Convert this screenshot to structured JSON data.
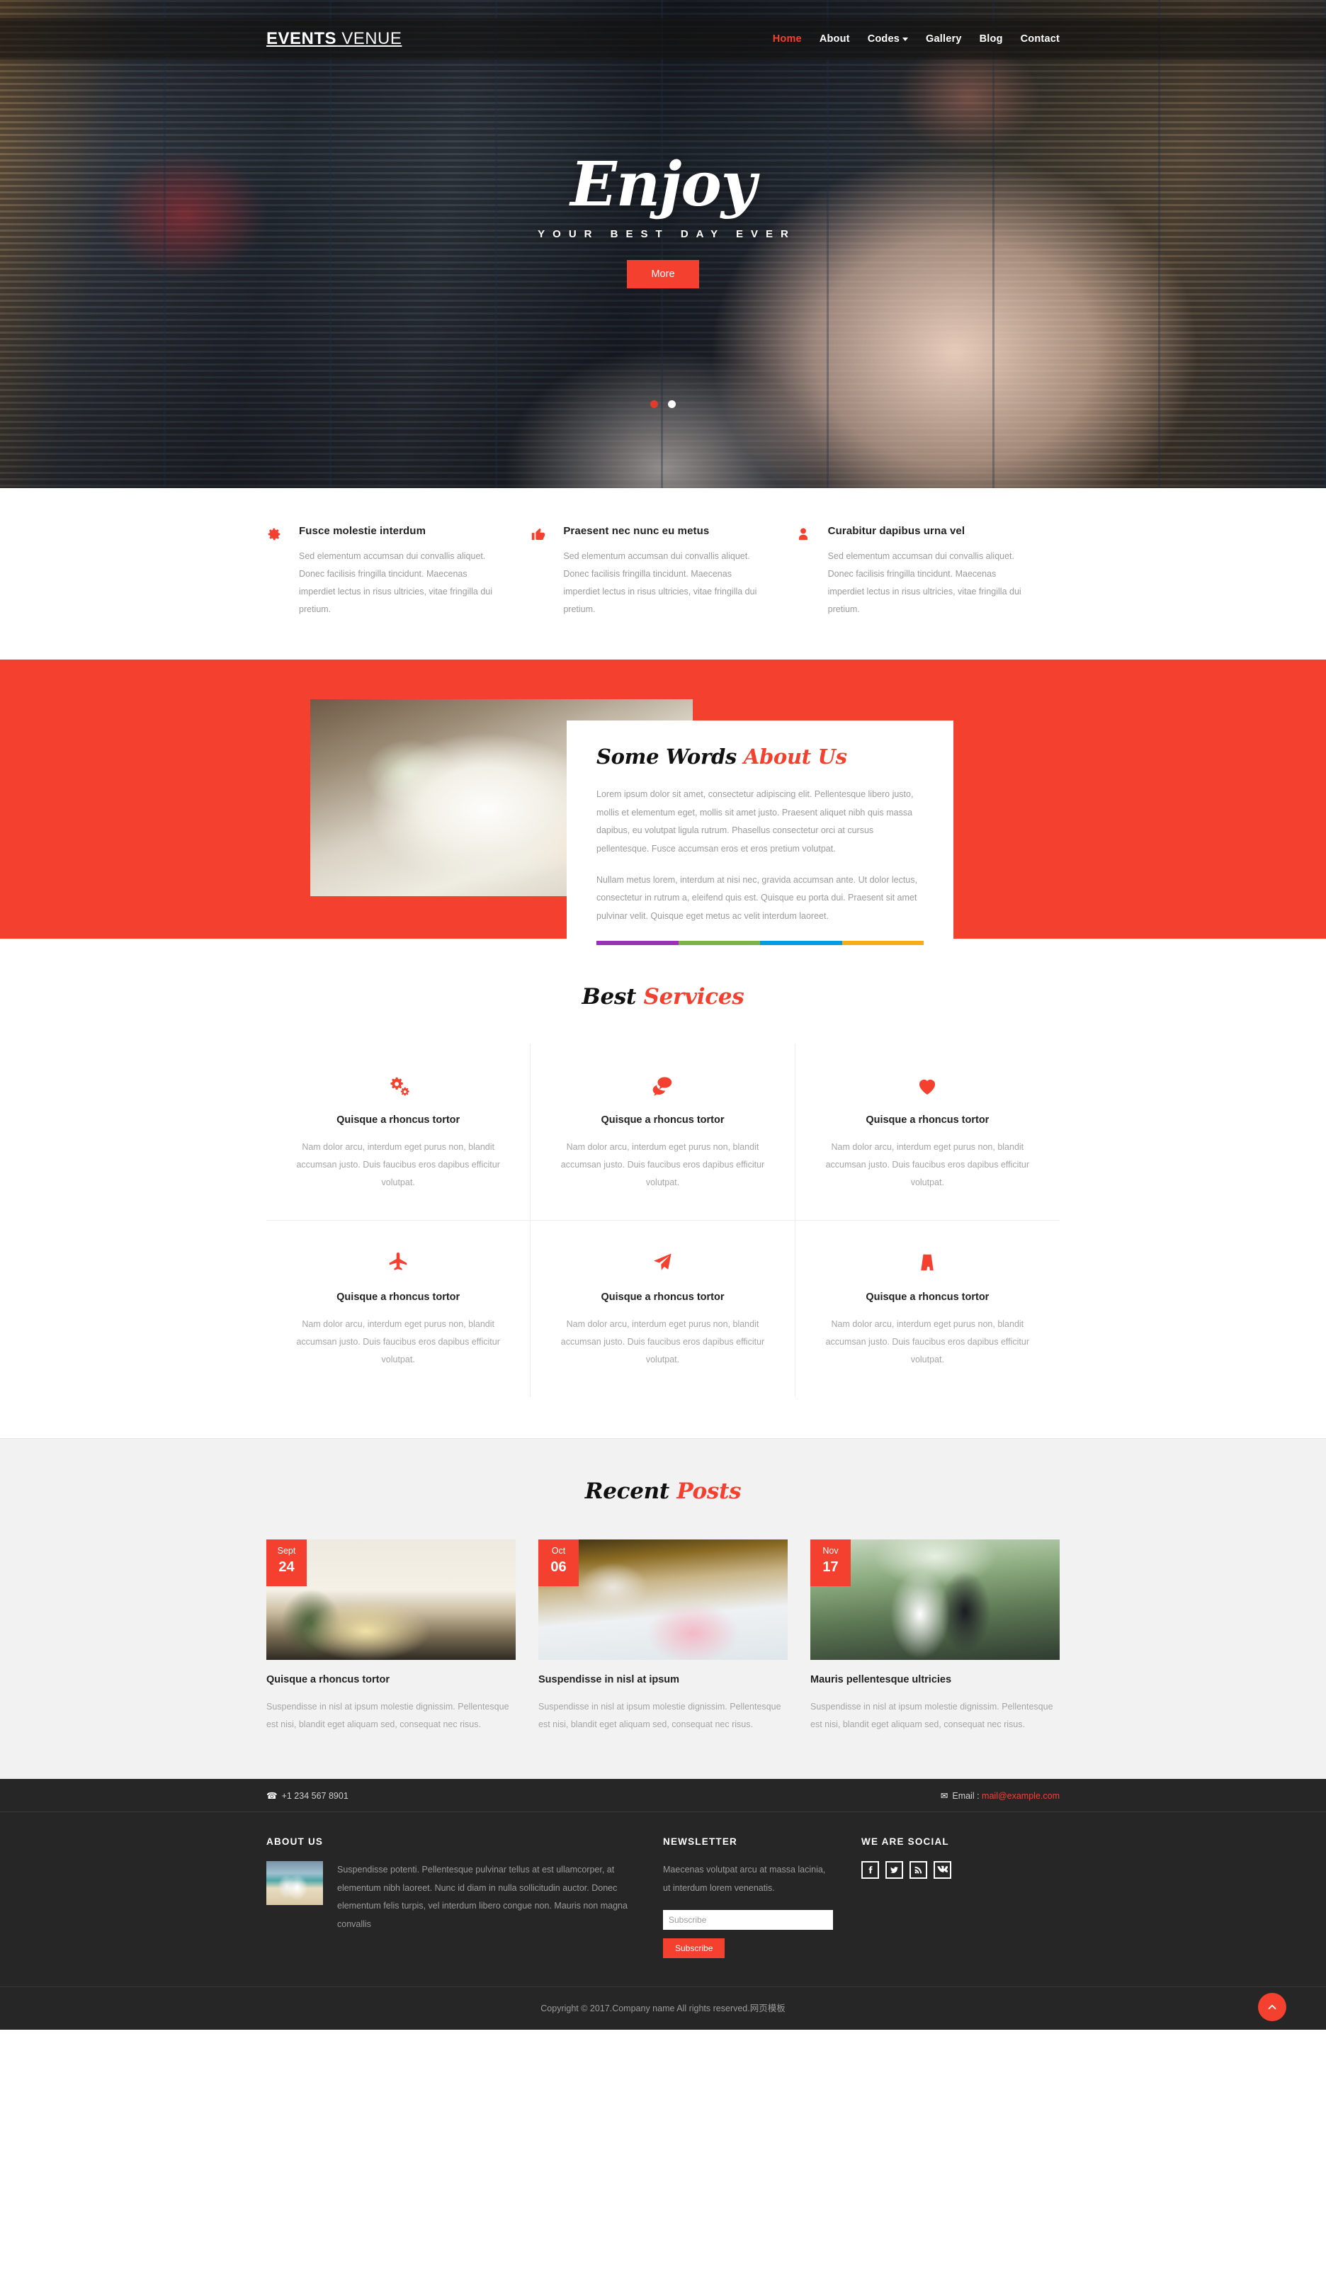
{
  "colors": {
    "accent": "#f4402f",
    "dark": "#262626",
    "muted": "#9b9b9b",
    "stripe": [
      "#9b30b8",
      "#7cb342",
      "#039be5",
      "#fbaa19"
    ]
  },
  "header": {
    "logo_bold": "EVENTS",
    "logo_light": " VENUE",
    "nav": [
      {
        "label": "Home",
        "active": true,
        "caret": false
      },
      {
        "label": "About",
        "active": false,
        "caret": false
      },
      {
        "label": "Codes",
        "active": false,
        "caret": true
      },
      {
        "label": "Gallery",
        "active": false,
        "caret": false
      },
      {
        "label": "Blog",
        "active": false,
        "caret": false
      },
      {
        "label": "Contact",
        "active": false,
        "caret": false
      }
    ]
  },
  "hero": {
    "title": "Enjoy",
    "subtitle": "YOUR BEST DAY EVER",
    "button": "More",
    "dots": [
      {
        "active": false
      },
      {
        "active": true
      }
    ]
  },
  "features": [
    {
      "icon": "cog-icon",
      "title": "Fusce molestie interdum",
      "text": "Sed elementum accumsan dui convallis aliquet. Donec facilisis fringilla tincidunt. Maecenas imperdiet lectus in risus ultricies, vitae fringilla dui pretium."
    },
    {
      "icon": "thumbs-up-icon",
      "title": "Praesent nec nunc eu metus",
      "text": "Sed elementum accumsan dui convallis aliquet. Donec facilisis fringilla tincidunt. Maecenas imperdiet lectus in risus ultricies, vitae fringilla dui pretium."
    },
    {
      "icon": "user-icon",
      "title": "Curabitur dapibus urna vel",
      "text": "Sed elementum accumsan dui convallis aliquet. Donec facilisis fringilla tincidunt. Maecenas imperdiet lectus in risus ultricies, vitae fringilla dui pretium."
    }
  ],
  "about": {
    "title_dark": "Some Words ",
    "title_accent": "About Us",
    "paragraph1": "Lorem ipsum dolor sit amet, consectetur adipiscing elit. Pellentesque libero justo, mollis et elementum eget, mollis sit amet justo. Praesent aliquet nibh quis massa dapibus, eu volutpat ligula rutrum. Phasellus consectetur orci at cursus pellentesque. Fusce accumsan eros et eros pretium volutpat.",
    "paragraph2": "Nullam metus lorem, interdum at nisi nec, gravida accumsan ante. Ut dolor lectus, consectetur in rutrum a, eleifend quis est. Quisque eu porta dui. Praesent sit amet pulvinar velit. Quisque eget metus ac velit interdum laoreet."
  },
  "services": {
    "title_dark": "Best ",
    "title_accent": "Services",
    "items": [
      {
        "icon": "cogs-icon",
        "title": "Quisque a rhoncus tortor",
        "text": "Nam dolor arcu, interdum eget purus non, blandit accumsan justo. Duis faucibus eros dapibus efficitur volutpat."
      },
      {
        "icon": "comments-icon",
        "title": "Quisque a rhoncus tortor",
        "text": "Nam dolor arcu, interdum eget purus non, blandit accumsan justo. Duis faucibus eros dapibus efficitur volutpat."
      },
      {
        "icon": "heart-icon",
        "title": "Quisque a rhoncus tortor",
        "text": "Nam dolor arcu, interdum eget purus non, blandit accumsan justo. Duis faucibus eros dapibus efficitur volutpat."
      },
      {
        "icon": "plane-icon",
        "title": "Quisque a rhoncus tortor",
        "text": "Nam dolor arcu, interdum eget purus non, blandit accumsan justo. Duis faucibus eros dapibus efficitur volutpat."
      },
      {
        "icon": "paper-plane-icon",
        "title": "Quisque a rhoncus tortor",
        "text": "Nam dolor arcu, interdum eget purus non, blandit accumsan justo. Duis faucibus eros dapibus efficitur volutpat."
      },
      {
        "icon": "road-icon",
        "title": "Quisque a rhoncus tortor",
        "text": "Nam dolor arcu, interdum eget purus non, blandit accumsan justo. Duis faucibus eros dapibus efficitur volutpat."
      }
    ]
  },
  "posts": {
    "title_dark": "Recent ",
    "title_accent": "Posts",
    "items": [
      {
        "month": "Sept",
        "day": "24",
        "title": "Quisque a rhoncus tortor",
        "text": "Suspendisse in nisl at ipsum molestie dignissim. Pellentesque est nisi, blandit eget aliquam sed, consequat nec risus."
      },
      {
        "month": "Oct",
        "day": "06",
        "title": "Suspendisse in nisl at ipsum",
        "text": "Suspendisse in nisl at ipsum molestie dignissim. Pellentesque est nisi, blandit eget aliquam sed, consequat nec risus."
      },
      {
        "month": "Nov",
        "day": "17",
        "title": "Mauris pellentesque ultricies",
        "text": "Suspendisse in nisl at ipsum molestie dignissim. Pellentesque est nisi, blandit eget aliquam sed, consequat nec risus."
      }
    ]
  },
  "footer": {
    "phone": "+1 234 567 8901",
    "email_label": "Email : ",
    "email": "mail@example.com",
    "about_heading": "ABOUT US",
    "about_text": "Suspendisse potenti. Pellentesque pulvinar tellus at est ullamcorper, at elementum nibh laoreet. Nunc id diam in nulla sollicitudin auctor. Donec elementum felis turpis, vel interdum libero congue non. Mauris non magna convallis",
    "newsletter_heading": "NEWSLETTER",
    "newsletter_text": "Maecenas volutpat arcu at massa lacinia, ut interdum lorem venenatis.",
    "newsletter_placeholder": "Subscribe",
    "newsletter_button": "Subscribe",
    "social_heading": "WE ARE SOCIAL",
    "socials": [
      {
        "name": "facebook-icon"
      },
      {
        "name": "twitter-icon"
      },
      {
        "name": "rss-icon"
      },
      {
        "name": "vk-icon"
      }
    ],
    "copyright": "Copyright © 2017.Company name All rights reserved.网页模板"
  }
}
